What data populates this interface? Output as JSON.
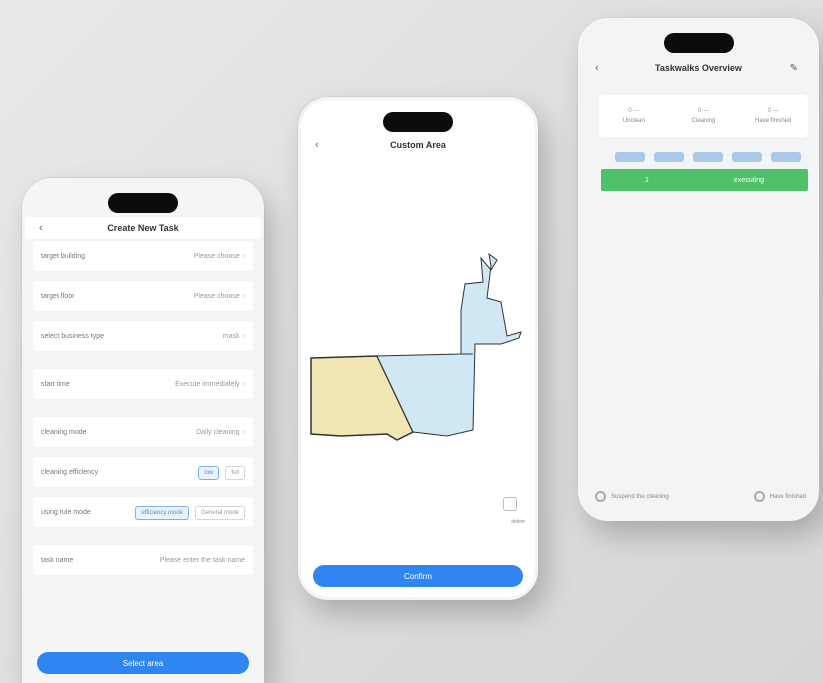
{
  "create_task": {
    "title": "Create New Task",
    "rows": [
      {
        "label": "target building",
        "value": "Please choose"
      },
      {
        "label": "target floor",
        "value": "Please choose"
      },
      {
        "label": "select business type",
        "value": "mask"
      },
      {
        "label": "start time",
        "value": "Execute immediately"
      },
      {
        "label": "cleaning mode",
        "value": "Daily cleaning"
      }
    ],
    "efficiency": {
      "label": "cleaning efficiency",
      "options": [
        "low",
        "full"
      ],
      "selected": "low"
    },
    "rule_mode": {
      "label": "using rule mode",
      "options": [
        "efficiency mode",
        "General mode"
      ],
      "selected": "efficiency mode"
    },
    "task_name": {
      "label": "task name",
      "placeholder": "Please enter the task name"
    },
    "select_area_button": "Select area"
  },
  "custom_area": {
    "title": "Custom Area",
    "confirm_button": "Confirm",
    "tool_label": "delete",
    "colors": {
      "zone_yellow": "#f1e7b5",
      "zone_blue": "#cfe8f3"
    }
  },
  "overview": {
    "title": "Taskwalks Overview",
    "stats": [
      {
        "num": "0 —",
        "label": "Unclean"
      },
      {
        "num": "0 —",
        "label": "Cleaning"
      },
      {
        "num": "0 —",
        "label": "Have finished"
      }
    ],
    "progress": {
      "left": "1",
      "status": "executing"
    },
    "suspend": "Suspend the cleaning",
    "finished": "Have finished",
    "colors": {
      "progress": "#4fc16a",
      "primary": "#2f86f2"
    }
  }
}
